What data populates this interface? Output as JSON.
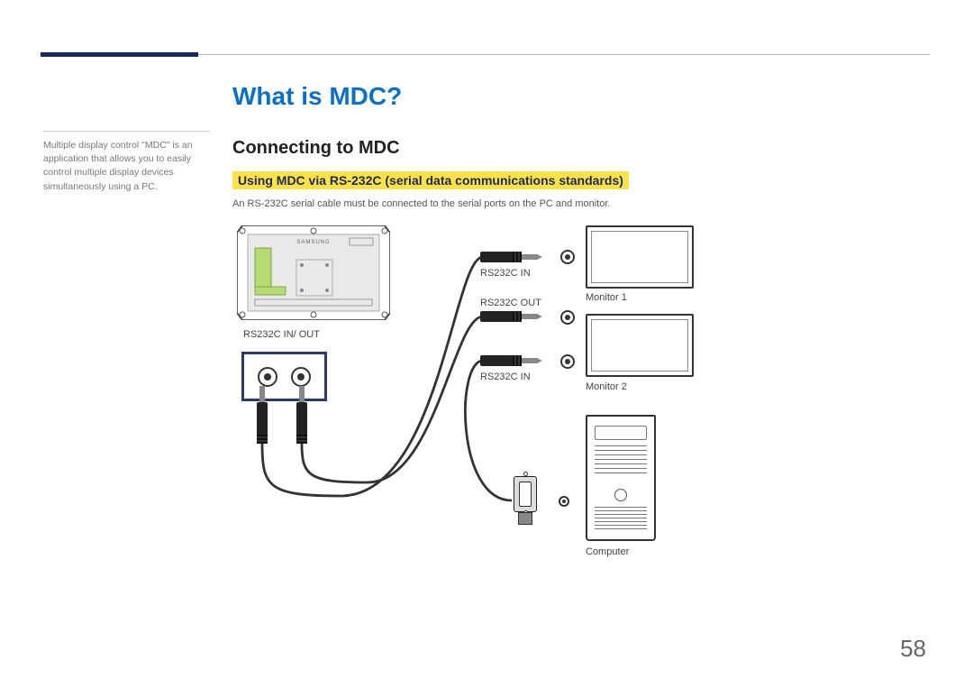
{
  "page_number": "58",
  "sidebar": {
    "desc": "Multiple display control \"MDC\" is an application that allows you to easily control multiple display devices simultaneously using a PC."
  },
  "main": {
    "title": "What is MDC?",
    "section_title": "Connecting to MDC",
    "sub_title": "Using MDC via RS-232C (serial data communications standards)",
    "body": "An RS-232C serial cable must be connected to the serial ports on the PC and monitor."
  },
  "diagram": {
    "port_panel_label": "RS232C IN/ OUT",
    "jack_top_label": "RS232C IN",
    "jack_mid_label": "RS232C OUT",
    "jack_bot_label": "RS232C IN",
    "monitor1_label": "Monitor 1",
    "monitor2_label": "Monitor 2",
    "computer_label": "Computer",
    "brand_label": "SAMSUNG"
  }
}
